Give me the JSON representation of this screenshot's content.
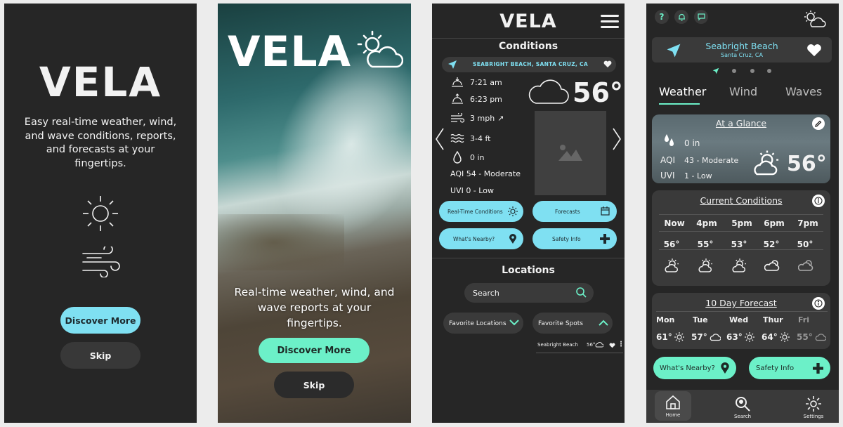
{
  "screen1": {
    "logo": "VELA",
    "tagline": "Easy real-time weather, wind, and wave conditions, reports, and forecasts at your fingertips.",
    "discover_btn": "Discover More",
    "skip_btn": "Skip"
  },
  "screen2": {
    "logo": "VELA",
    "tagline": "Real-time weather, wind, and wave reports at your fingertips.",
    "discover_btn": "Discover More",
    "skip_btn": "Skip"
  },
  "screen3": {
    "logo": "VELA",
    "conditions_title": "Conditions",
    "location": "SEABRIGHT BEACH, SANTA CRUZ, CA",
    "sunrise": "7:21 am",
    "sunset": "6:23 pm",
    "wind": "3 mph",
    "waves": "3-4 ft",
    "rain": "0 in",
    "aqi": "AQI  54 - Moderate",
    "uvi": "UVI  0 - Low",
    "temp": "56°",
    "buttons": [
      "Real-Time Conditions",
      "Forecasts",
      "What's Nearby?",
      "Safety Info"
    ],
    "locations_title": "Locations",
    "search_placeholder": "Search",
    "fav_locations": "Favorite Locations",
    "fav_spots": "Favorite Spots",
    "spot_name": "Seabright Beach",
    "spot_temp": "56°"
  },
  "screen4": {
    "location_name": "Seabright Beach",
    "location_sub": "Santa Cruz, CA",
    "tabs": [
      "Weather",
      "Wind",
      "Waves"
    ],
    "glance_title": "At a Glance",
    "glance_rain": "0 in",
    "glance_aqi_label": "AQI",
    "glance_aqi": "43 - Moderate",
    "glance_uvi_label": "UVI",
    "glance_uvi": "1 - Low",
    "glance_temp": "56°",
    "current_title": "Current Conditions",
    "hours": [
      "Now",
      "4pm",
      "5pm",
      "6pm",
      "7pm"
    ],
    "hour_temps": [
      "56°",
      "55°",
      "53°",
      "52°",
      "50°"
    ],
    "forecast_title": "10 Day Forecast",
    "days": [
      "Mon",
      "Tue",
      "Wed",
      "Thur",
      "Fri"
    ],
    "day_temps": [
      "61°",
      "57°",
      "63°",
      "64°",
      "55°"
    ],
    "nearby_btn": "What's Nearby?",
    "safety_btn": "Safety Info",
    "nav": [
      "Home",
      "Search",
      "Settings"
    ]
  },
  "colors": {
    "accent_blue": "#7fe0f2",
    "accent_mint": "#6cf0c8",
    "bg_dark": "#262626",
    "card": "#3a3a3a"
  }
}
